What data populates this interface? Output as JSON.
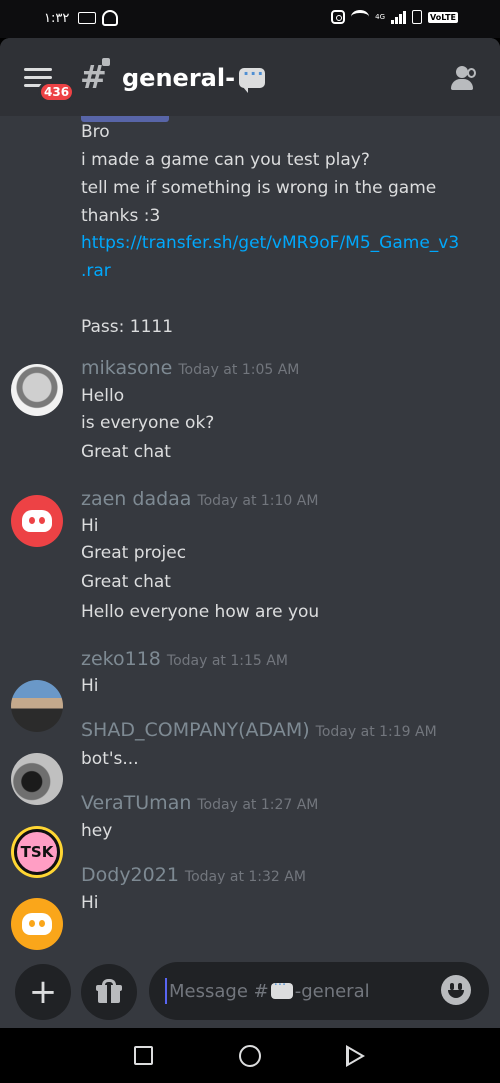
{
  "status_bar": {
    "time": "١:٣٢",
    "network_label": "4G",
    "volte": "VoLTE"
  },
  "header": {
    "badge_count": "436",
    "channel_name": "general-"
  },
  "messages": {
    "continued": {
      "lines": [
        "Bro",
        "i made a game can you test play?",
        "tell me if something is wrong in the game",
        "thanks :3"
      ],
      "link_line1": "https://transfer.sh/get/vMR9oF/M5_Game_v3",
      "link_line2": ".rar",
      "password": "Pass: 1111"
    },
    "groups": [
      {
        "author": "mikasone",
        "timestamp": "Today at 1:05 AM",
        "lines": [
          "Hello",
          "is everyone ok?",
          "Great chat"
        ]
      },
      {
        "author": "zaen dadaa",
        "timestamp": "Today at 1:10 AM",
        "lines": [
          "Hi",
          "Great projec",
          "Great chat",
          "Hello everyone how are you"
        ]
      },
      {
        "author": "zeko118",
        "timestamp": "Today at 1:15 AM",
        "lines": [
          "Hi"
        ]
      },
      {
        "author": "SHAD_COMPANY(ADAM)",
        "timestamp": "Today at 1:19 AM",
        "lines": [
          "bot's..."
        ]
      },
      {
        "author": "VeraTUman",
        "timestamp": "Today at 1:27 AM",
        "lines": [
          "hey"
        ]
      },
      {
        "author": "Dody2021",
        "timestamp": "Today at 1:32 AM",
        "lines": [
          "Hi"
        ]
      }
    ]
  },
  "composer": {
    "placeholder_prefix": "Message #",
    "placeholder_suffix": "-general",
    "plus_symbol": "+"
  },
  "colors": {
    "background": "#36393f",
    "header": "#2f3136",
    "link": "#00a8fc",
    "badge": "#ed4245",
    "discord_red": "#ed4245",
    "discord_orange": "#faa61a"
  }
}
